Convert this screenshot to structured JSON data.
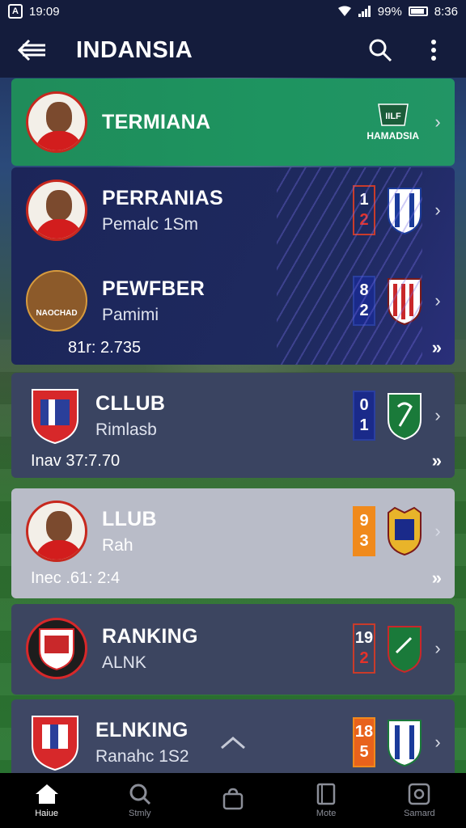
{
  "status": {
    "time": "19:09",
    "battery": "99%",
    "clock_right": "8:36"
  },
  "app_bar": {
    "title": "INDANSIA"
  },
  "cards": [
    {
      "title": "TERMIANA",
      "brand": "HAMADSIA"
    },
    {
      "title": "PERRANIAS",
      "subtitle": "Pemalc 1Sm",
      "score_top": "1",
      "score_bottom": "2"
    },
    {
      "title": "PEWFBER",
      "subtitle": "Pamimi",
      "crest_label": "NAOCHAD",
      "footnote": "81r: 2.735",
      "score_top": "8",
      "score_bottom": "2"
    },
    {
      "title": "CLLUB",
      "subtitle": "Rimlasb",
      "footnote": "Inav 37:7.70",
      "score_top": "0",
      "score_bottom": "1"
    },
    {
      "title": "LLUB",
      "subtitle": "Rah",
      "footnote": "Inec .61: 2:4",
      "score_top": "9",
      "score_bottom": "3"
    },
    {
      "title": "RANKING",
      "subtitle": "ALNK",
      "score_top": "19",
      "score_bottom": "2"
    },
    {
      "title": "ELNKING",
      "subtitle": "Ranahc 1S2",
      "score_top": "18",
      "score_bottom": "5"
    }
  ],
  "bottom_nav": [
    {
      "label": "Haiue",
      "icon": "home-icon"
    },
    {
      "label": "Stmly",
      "icon": "search-icon"
    },
    {
      "label": "",
      "icon": "bag-icon"
    },
    {
      "label": "Mote",
      "icon": "book-icon"
    },
    {
      "label": "Samard",
      "icon": "camera-icon"
    }
  ],
  "colors": {
    "accent_green": "#1f8c5a",
    "navy": "#141c3c",
    "red": "#d21d1d"
  }
}
